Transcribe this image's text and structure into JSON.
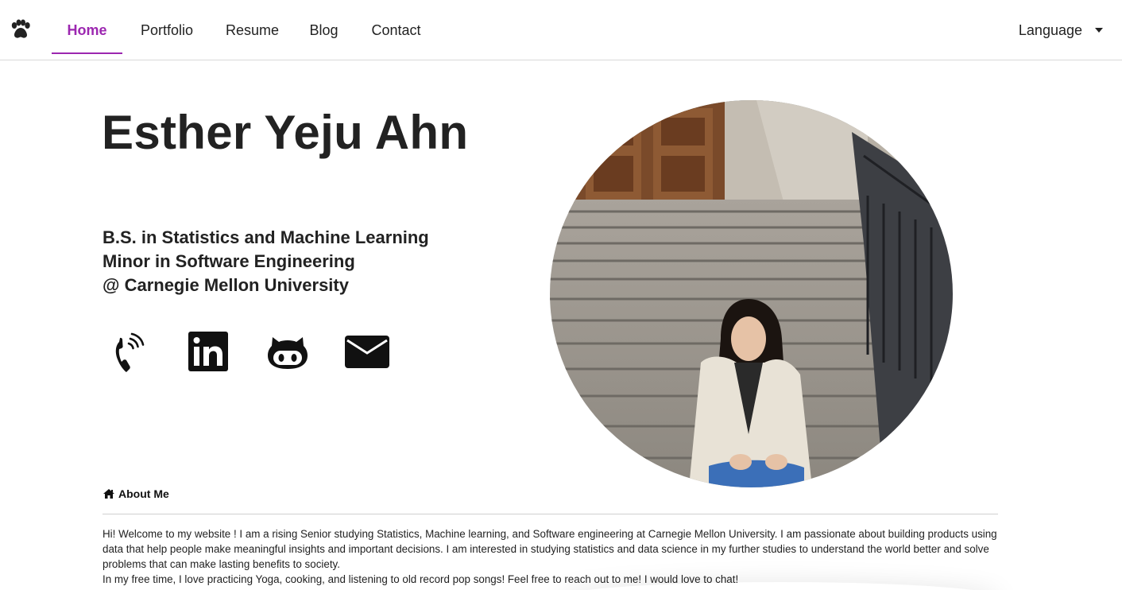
{
  "nav": {
    "logo_icon": "paw-icon",
    "tabs": [
      {
        "label": "Home",
        "active": true
      },
      {
        "label": "Portfolio",
        "active": false
      },
      {
        "label": "Resume",
        "active": false
      },
      {
        "label": "Blog",
        "active": false
      },
      {
        "label": "Contact",
        "active": false
      }
    ],
    "language_label": "Language",
    "accent_color": "#9c27b0"
  },
  "hero": {
    "name": "Esther Yeju Ahn",
    "degree_lines": [
      "B.S. in Statistics and Machine Learning",
      "Minor in Software Engineering",
      "@ Carnegie Mellon University"
    ],
    "contact_icons": [
      "phone-icon",
      "linkedin-icon",
      "github-icon",
      "email-icon"
    ],
    "photo_alt": "profile-photo"
  },
  "about": {
    "icon": "home-icon",
    "heading": "About Me",
    "paragraph1": "Hi! Welcome to my website ! I am a rising Senior studying Statistics, Machine learning, and Software engineering at Carnegie Mellon University. I am passionate about building products using data that help people make meaningful insights and important decisions. I am interested in studying statistics and data science in my further studies to understand the world better and solve problems that can make lasting benefits to society.",
    "paragraph2": "In my free time, I love practicing Yoga, cooking, and listening to old record pop songs! Feel free to reach out to me! I would love to chat!"
  }
}
